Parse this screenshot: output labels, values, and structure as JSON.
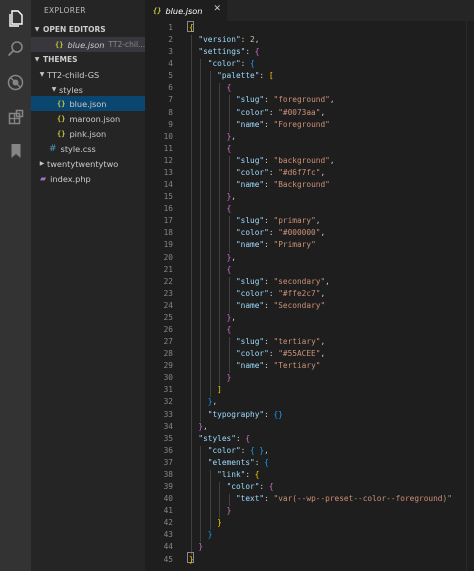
{
  "explorer": {
    "title": "EXPLORER",
    "open_editors_label": "OPEN EDITORS",
    "open_editor": {
      "name": "blue.json",
      "path": "TT2-chil..."
    },
    "workspace_label": "THEMES",
    "tree": [
      {
        "label": "TT2-child-GS",
        "kind": "folder-open"
      },
      {
        "label": "styles",
        "kind": "folder-open"
      },
      {
        "label": "blue.json",
        "kind": "json",
        "active": true
      },
      {
        "label": "maroon.json",
        "kind": "json"
      },
      {
        "label": "pink.json",
        "kind": "json"
      },
      {
        "label": "style.css",
        "kind": "css"
      },
      {
        "label": "twentytwentytwo",
        "kind": "folder-closed"
      },
      {
        "label": "index.php",
        "kind": "php"
      }
    ]
  },
  "activity_icons": [
    "files-icon",
    "search-icon",
    "debug-icon",
    "extensions-icon",
    "bookmark-icon"
  ],
  "editor": {
    "tab_label": "blue.json",
    "tab_icon": "{}",
    "lines": [
      [
        [
          "{",
          "b1"
        ]
      ],
      [
        [
          "  ",
          "p"
        ],
        [
          "\"version\"",
          "k"
        ],
        [
          ": ",
          "p"
        ],
        [
          "2",
          "n"
        ],
        [
          ",",
          "p"
        ]
      ],
      [
        [
          "  ",
          "p"
        ],
        [
          "\"settings\"",
          "k"
        ],
        [
          ": ",
          "p"
        ],
        [
          "{",
          "b2"
        ]
      ],
      [
        [
          "    ",
          "p"
        ],
        [
          "\"color\"",
          "k"
        ],
        [
          ": ",
          "p"
        ],
        [
          "{",
          "b3"
        ]
      ],
      [
        [
          "      ",
          "p"
        ],
        [
          "\"palette\"",
          "k"
        ],
        [
          ": ",
          "p"
        ],
        [
          "[",
          "b1"
        ]
      ],
      [
        [
          "        ",
          "p"
        ],
        [
          "{",
          "b2"
        ]
      ],
      [
        [
          "          ",
          "p"
        ],
        [
          "\"slug\"",
          "k"
        ],
        [
          ": ",
          "p"
        ],
        [
          "\"foreground\"",
          "s"
        ],
        [
          ",",
          "p"
        ]
      ],
      [
        [
          "          ",
          "p"
        ],
        [
          "\"color\"",
          "k"
        ],
        [
          ": ",
          "p"
        ],
        [
          "\"#0073aa\"",
          "s"
        ],
        [
          ",",
          "p"
        ]
      ],
      [
        [
          "          ",
          "p"
        ],
        [
          "\"name\"",
          "k"
        ],
        [
          ": ",
          "p"
        ],
        [
          "\"Foreground\"",
          "s"
        ]
      ],
      [
        [
          "        ",
          "p"
        ],
        [
          "}",
          "b2"
        ],
        [
          ",",
          "p"
        ]
      ],
      [
        [
          "        ",
          "p"
        ],
        [
          "{",
          "b2"
        ]
      ],
      [
        [
          "          ",
          "p"
        ],
        [
          "\"slug\"",
          "k"
        ],
        [
          ": ",
          "p"
        ],
        [
          "\"background\"",
          "s"
        ],
        [
          ",",
          "p"
        ]
      ],
      [
        [
          "          ",
          "p"
        ],
        [
          "\"color\"",
          "k"
        ],
        [
          ": ",
          "p"
        ],
        [
          "\"#d6f7fc\"",
          "s"
        ],
        [
          ",",
          "p"
        ]
      ],
      [
        [
          "          ",
          "p"
        ],
        [
          "\"name\"",
          "k"
        ],
        [
          ": ",
          "p"
        ],
        [
          "\"Background\"",
          "s"
        ]
      ],
      [
        [
          "        ",
          "p"
        ],
        [
          "}",
          "b2"
        ],
        [
          ",",
          "p"
        ]
      ],
      [
        [
          "        ",
          "p"
        ],
        [
          "{",
          "b2"
        ]
      ],
      [
        [
          "          ",
          "p"
        ],
        [
          "\"slug\"",
          "k"
        ],
        [
          ": ",
          "p"
        ],
        [
          "\"primary\"",
          "s"
        ],
        [
          ",",
          "p"
        ]
      ],
      [
        [
          "          ",
          "p"
        ],
        [
          "\"color\"",
          "k"
        ],
        [
          ": ",
          "p"
        ],
        [
          "\"#000000\"",
          "s"
        ],
        [
          ",",
          "p"
        ]
      ],
      [
        [
          "          ",
          "p"
        ],
        [
          "\"name\"",
          "k"
        ],
        [
          ": ",
          "p"
        ],
        [
          "\"Primary\"",
          "s"
        ]
      ],
      [
        [
          "        ",
          "p"
        ],
        [
          "}",
          "b2"
        ],
        [
          ",",
          "p"
        ]
      ],
      [
        [
          "        ",
          "p"
        ],
        [
          "{",
          "b2"
        ]
      ],
      [
        [
          "          ",
          "p"
        ],
        [
          "\"slug\"",
          "k"
        ],
        [
          ": ",
          "p"
        ],
        [
          "\"secondary\"",
          "s"
        ],
        [
          ",",
          "p"
        ]
      ],
      [
        [
          "          ",
          "p"
        ],
        [
          "\"color\"",
          "k"
        ],
        [
          ": ",
          "p"
        ],
        [
          "\"#ffe2c7\"",
          "s"
        ],
        [
          ",",
          "p"
        ]
      ],
      [
        [
          "          ",
          "p"
        ],
        [
          "\"name\"",
          "k"
        ],
        [
          ": ",
          "p"
        ],
        [
          "\"Secondary\"",
          "s"
        ]
      ],
      [
        [
          "        ",
          "p"
        ],
        [
          "}",
          "b2"
        ],
        [
          ",",
          "p"
        ]
      ],
      [
        [
          "        ",
          "p"
        ],
        [
          "{",
          "b2"
        ]
      ],
      [
        [
          "          ",
          "p"
        ],
        [
          "\"slug\"",
          "k"
        ],
        [
          ": ",
          "p"
        ],
        [
          "\"tertiary\"",
          "s"
        ],
        [
          ",",
          "p"
        ]
      ],
      [
        [
          "          ",
          "p"
        ],
        [
          "\"color\"",
          "k"
        ],
        [
          ": ",
          "p"
        ],
        [
          "\"#55ACEE\"",
          "s"
        ],
        [
          ",",
          "p"
        ]
      ],
      [
        [
          "          ",
          "p"
        ],
        [
          "\"name\"",
          "k"
        ],
        [
          ": ",
          "p"
        ],
        [
          "\"Tertiary\"",
          "s"
        ]
      ],
      [
        [
          "        ",
          "p"
        ],
        [
          "}",
          "b2"
        ]
      ],
      [
        [
          "      ",
          "p"
        ],
        [
          "]",
          "b1"
        ]
      ],
      [
        [
          "    ",
          "p"
        ],
        [
          "}",
          "b3"
        ],
        [
          ",",
          "p"
        ]
      ],
      [
        [
          "    ",
          "p"
        ],
        [
          "\"typography\"",
          "k"
        ],
        [
          ": ",
          "p"
        ],
        [
          "{}",
          "b3"
        ]
      ],
      [
        [
          "  ",
          "p"
        ],
        [
          "}",
          "b2"
        ],
        [
          ",",
          "p"
        ]
      ],
      [
        [
          "  ",
          "p"
        ],
        [
          "\"styles\"",
          "k"
        ],
        [
          ": ",
          "p"
        ],
        [
          "{",
          "b2"
        ]
      ],
      [
        [
          "    ",
          "p"
        ],
        [
          "\"color\"",
          "k"
        ],
        [
          ": ",
          "p"
        ],
        [
          "{ }",
          "b3"
        ],
        [
          ",",
          "p"
        ]
      ],
      [
        [
          "    ",
          "p"
        ],
        [
          "\"elements\"",
          "k"
        ],
        [
          ": ",
          "p"
        ],
        [
          "{",
          "b3"
        ]
      ],
      [
        [
          "      ",
          "p"
        ],
        [
          "\"link\"",
          "k"
        ],
        [
          ": ",
          "p"
        ],
        [
          "{",
          "b1"
        ]
      ],
      [
        [
          "        ",
          "p"
        ],
        [
          "\"color\"",
          "k"
        ],
        [
          ": ",
          "p"
        ],
        [
          "{",
          "b2"
        ]
      ],
      [
        [
          "          ",
          "p"
        ],
        [
          "\"text\"",
          "k"
        ],
        [
          ": ",
          "p"
        ],
        [
          "\"var(--wp--preset--color--foreground)\"",
          "s"
        ]
      ],
      [
        [
          "        ",
          "p"
        ],
        [
          "}",
          "b2"
        ]
      ],
      [
        [
          "      ",
          "p"
        ],
        [
          "}",
          "b1"
        ]
      ],
      [
        [
          "    ",
          "p"
        ],
        [
          "}",
          "b3"
        ]
      ],
      [
        [
          "  ",
          "p"
        ],
        [
          "}",
          "b2"
        ]
      ],
      [
        [
          "}",
          "b1"
        ]
      ]
    ]
  },
  "colors": {
    "editor_bg": "#1e1e1e",
    "sidebar_bg": "#252526",
    "activity_bg": "#333333",
    "key": "#9cdcfe",
    "string": "#ce9178",
    "number": "#b5cea8",
    "json_icon": "#cbcb41"
  }
}
